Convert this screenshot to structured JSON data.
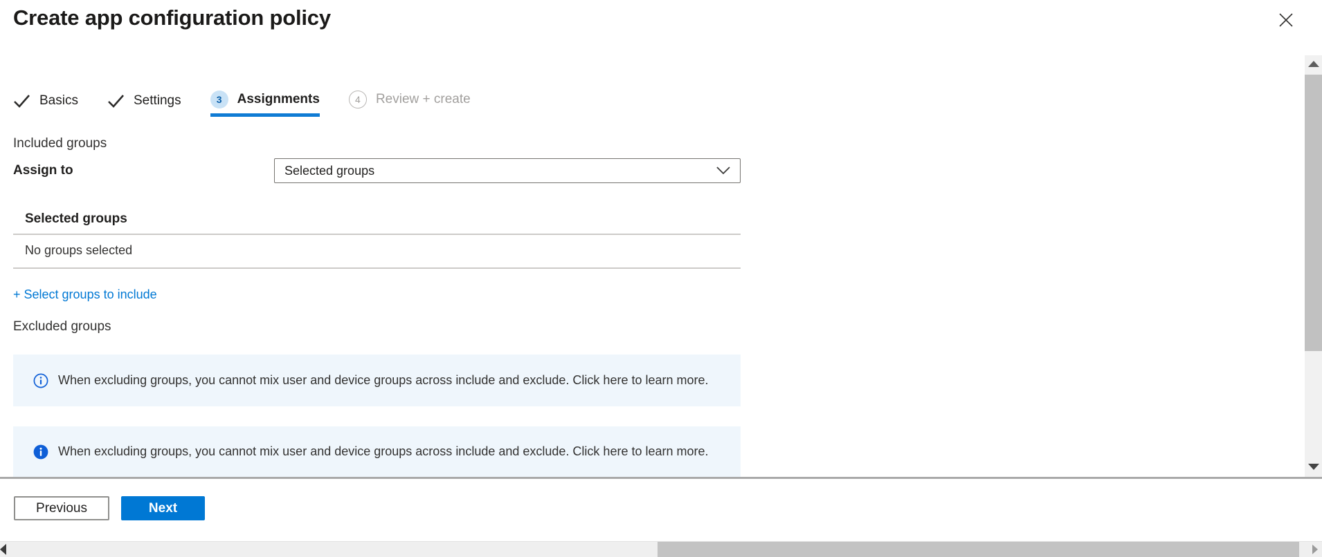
{
  "header": {
    "title": "Create app configuration policy",
    "close_icon": "close-x"
  },
  "tabs": [
    {
      "label": "Basics",
      "state": "completed",
      "icon": "checkmark"
    },
    {
      "label": "Settings",
      "state": "completed",
      "icon": "checkmark"
    },
    {
      "label": "Assignments",
      "state": "active",
      "number": "3"
    },
    {
      "label": "Review + create",
      "state": "disabled",
      "number": "4"
    }
  ],
  "included": {
    "section_label": "Included groups",
    "assign_to_label": "Assign to",
    "assign_to_value": "Selected groups",
    "table_header": "Selected groups",
    "empty_text": "No groups selected",
    "add_link": "+ Select groups to include"
  },
  "excluded": {
    "section_label": "Excluded groups",
    "banners": [
      {
        "icon": "info-outline",
        "text": "When excluding groups, you cannot mix user and device groups across include and exclude.  Click here to learn more."
      },
      {
        "icon": "info-solid",
        "text": "When excluding groups, you cannot mix user and device groups across include and exclude. Click here to learn more."
      }
    ]
  },
  "footer": {
    "previous_label": "Previous",
    "next_label": "Next"
  },
  "colors": {
    "accent": "#0078d4",
    "active_underline": "#0f7bd4",
    "badge_active_bg": "#c9e2f6",
    "badge_active_text": "#0b5fa8",
    "disabled_text": "#a19f9d",
    "banner_bg": "#eff6fc",
    "info_icon_blue": "#0f5fd7",
    "link": "#0078d4",
    "divider": "#cccac8",
    "footer_divider": "#a9a9a9",
    "scroll_track": "#f1f1f1",
    "scroll_thumb": "#c1c1c1"
  }
}
